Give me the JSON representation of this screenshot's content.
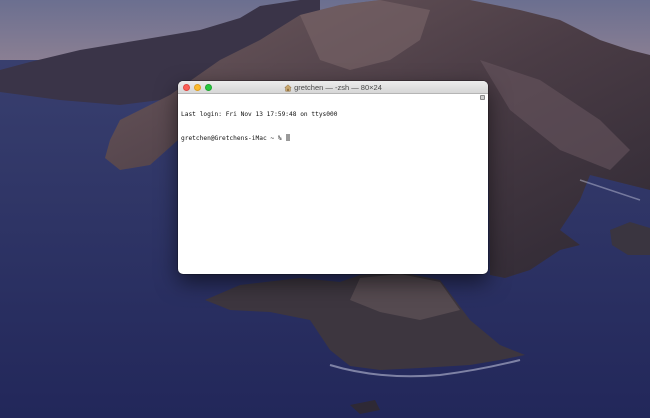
{
  "window": {
    "title": "gretchen — -zsh — 80×24",
    "title_icon": "home-folder-icon"
  },
  "terminal": {
    "last_login": "Last login: Fri Nov 13 17:59:48 on ttys000",
    "prompt": "gretchen@Gretchens-iMac ~ %"
  },
  "colors": {
    "close": "#fc5f57",
    "minimize": "#fdbb2e",
    "zoom": "#28c840"
  }
}
